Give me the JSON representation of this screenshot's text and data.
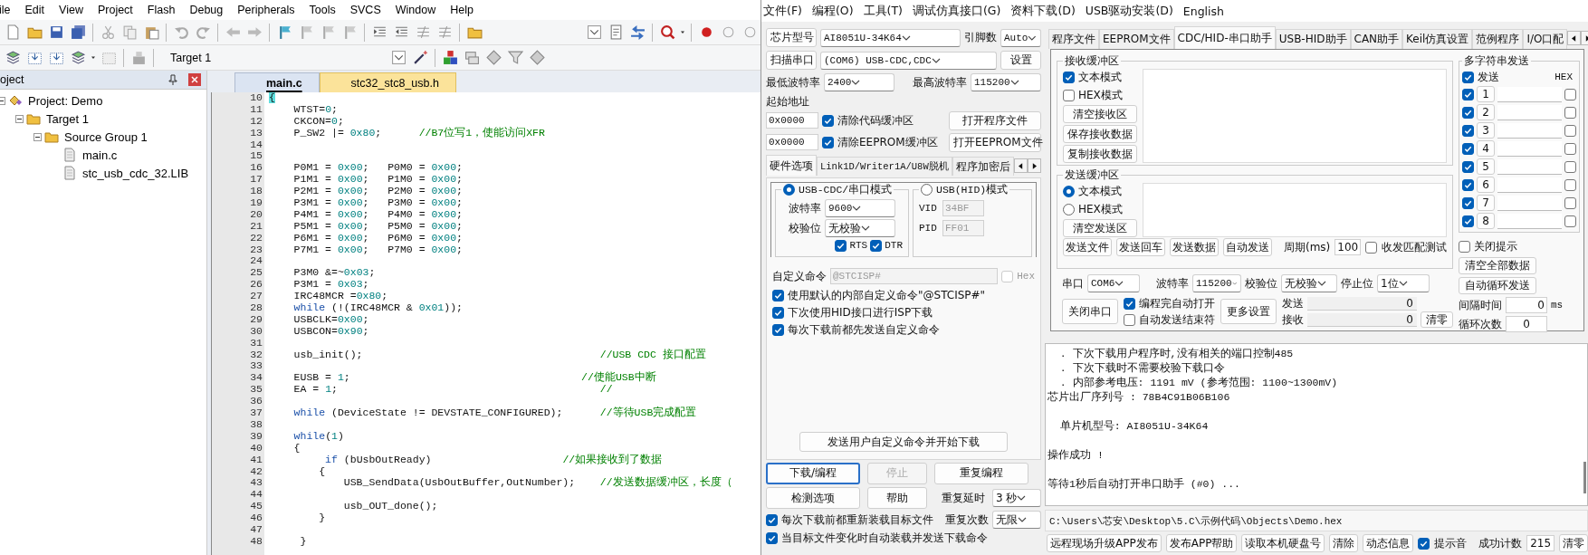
{
  "ide": {
    "menu": [
      "ile",
      "Edit",
      "View",
      "Project",
      "Flash",
      "Debug",
      "Peripherals",
      "Tools",
      "SVCS",
      "Window",
      "Help"
    ],
    "target": "Target 1",
    "project_title": "oject",
    "tree": [
      {
        "label": "Project: Demo",
        "expanded": true,
        "children": [
          {
            "label": "Target 1",
            "expanded": true,
            "children": [
              {
                "label": "Source Group 1",
                "expanded": true,
                "children": [
                  {
                    "label": "main.c"
                  },
                  {
                    "label": "stc_usb_cdc_32.LIB"
                  }
                ]
              }
            ]
          }
        ]
      }
    ],
    "editor_tabs": [
      {
        "label": "main.c",
        "selected": true
      },
      {
        "label": "stc32_stc8_usb.h",
        "selected": false
      }
    ],
    "code": [
      {
        "number": "10",
        "segments": [
          {
            "kind": "brace",
            "text": "{"
          }
        ]
      },
      {
        "number": "11",
        "segments": [
          {
            "kind": "plain",
            "text": "    WTST="
          },
          {
            "kind": "num",
            "text": "0"
          },
          {
            "kind": "plain",
            "text": ";"
          }
        ]
      },
      {
        "number": "12",
        "segments": [
          {
            "kind": "plain",
            "text": "    CKCON="
          },
          {
            "kind": "num",
            "text": "0"
          },
          {
            "kind": "plain",
            "text": ";"
          }
        ]
      },
      {
        "number": "13",
        "segments": [
          {
            "kind": "plain",
            "text": "    P_SW2 |= "
          },
          {
            "kind": "num",
            "text": "0x80"
          },
          {
            "kind": "plain",
            "text": ";      "
          },
          {
            "kind": "cmt",
            "text": "//B7位写1，使能访问XFR"
          }
        ]
      },
      {
        "number": "14"
      },
      {
        "number": "15"
      },
      {
        "number": "16",
        "segments": [
          {
            "kind": "plain",
            "text": "    P0M1 = "
          },
          {
            "kind": "num",
            "text": "0x00"
          },
          {
            "kind": "plain",
            "text": ";   P0M0 = "
          },
          {
            "kind": "num",
            "text": "0x00"
          },
          {
            "kind": "plain",
            "text": ";"
          }
        ]
      },
      {
        "number": "17",
        "segments": [
          {
            "kind": "plain",
            "text": "    P1M1 = "
          },
          {
            "kind": "num",
            "text": "0x00"
          },
          {
            "kind": "plain",
            "text": ";   P1M0 = "
          },
          {
            "kind": "num",
            "text": "0x00"
          },
          {
            "kind": "plain",
            "text": ";"
          }
        ]
      },
      {
        "number": "18",
        "segments": [
          {
            "kind": "plain",
            "text": "    P2M1 = "
          },
          {
            "kind": "num",
            "text": "0x00"
          },
          {
            "kind": "plain",
            "text": ";   P2M0 = "
          },
          {
            "kind": "num",
            "text": "0x00"
          },
          {
            "kind": "plain",
            "text": ";"
          }
        ]
      },
      {
        "number": "19",
        "segments": [
          {
            "kind": "plain",
            "text": "    P3M1 = "
          },
          {
            "kind": "num",
            "text": "0x00"
          },
          {
            "kind": "plain",
            "text": ";   P3M0 = "
          },
          {
            "kind": "num",
            "text": "0x00"
          },
          {
            "kind": "plain",
            "text": ";"
          }
        ]
      },
      {
        "number": "20",
        "segments": [
          {
            "kind": "plain",
            "text": "    P4M1 = "
          },
          {
            "kind": "num",
            "text": "0x00"
          },
          {
            "kind": "plain",
            "text": ";   P4M0 = "
          },
          {
            "kind": "num",
            "text": "0x00"
          },
          {
            "kind": "plain",
            "text": ";"
          }
        ]
      },
      {
        "number": "21",
        "segments": [
          {
            "kind": "plain",
            "text": "    P5M1 = "
          },
          {
            "kind": "num",
            "text": "0x00"
          },
          {
            "kind": "plain",
            "text": ";   P5M0 = "
          },
          {
            "kind": "num",
            "text": "0x00"
          },
          {
            "kind": "plain",
            "text": ";"
          }
        ]
      },
      {
        "number": "22",
        "segments": [
          {
            "kind": "plain",
            "text": "    P6M1 = "
          },
          {
            "kind": "num",
            "text": "0x00"
          },
          {
            "kind": "plain",
            "text": ";   P6M0 = "
          },
          {
            "kind": "num",
            "text": "0x00"
          },
          {
            "kind": "plain",
            "text": ";"
          }
        ]
      },
      {
        "number": "23",
        "segments": [
          {
            "kind": "plain",
            "text": "    P7M1 = "
          },
          {
            "kind": "num",
            "text": "0x00"
          },
          {
            "kind": "plain",
            "text": ";   P7M0 = "
          },
          {
            "kind": "num",
            "text": "0x00"
          },
          {
            "kind": "plain",
            "text": ";"
          }
        ]
      },
      {
        "number": "24"
      },
      {
        "number": "25",
        "segments": [
          {
            "kind": "plain",
            "text": "    P3M0 &=~"
          },
          {
            "kind": "num",
            "text": "0x03"
          },
          {
            "kind": "plain",
            "text": ";"
          }
        ]
      },
      {
        "number": "26",
        "segments": [
          {
            "kind": "plain",
            "text": "    P3M1 = "
          },
          {
            "kind": "num",
            "text": "0x03"
          },
          {
            "kind": "plain",
            "text": ";"
          }
        ]
      },
      {
        "number": "27",
        "segments": [
          {
            "kind": "plain",
            "text": "    IRC48MCR ="
          },
          {
            "kind": "num",
            "text": "0x80"
          },
          {
            "kind": "plain",
            "text": ";"
          }
        ]
      },
      {
        "number": "28",
        "segments": [
          {
            "kind": "kw",
            "text": "    while"
          },
          {
            "kind": "plain",
            "text": " (!(IRC48MCR & "
          },
          {
            "kind": "num",
            "text": "0x01"
          },
          {
            "kind": "plain",
            "text": "));"
          }
        ]
      },
      {
        "number": "29",
        "segments": [
          {
            "kind": "plain",
            "text": "    USBCLK="
          },
          {
            "kind": "num",
            "text": "0x00"
          },
          {
            "kind": "plain",
            "text": ";"
          }
        ]
      },
      {
        "number": "30",
        "segments": [
          {
            "kind": "plain",
            "text": "    USBCON="
          },
          {
            "kind": "num",
            "text": "0x90"
          },
          {
            "kind": "plain",
            "text": ";"
          }
        ]
      },
      {
        "number": "31"
      },
      {
        "number": "32",
        "segments": [
          {
            "kind": "plain",
            "text": "    usb_init();                                      "
          },
          {
            "kind": "cmt",
            "text": "//USB CDC 接口配置"
          }
        ]
      },
      {
        "number": "33"
      },
      {
        "number": "34",
        "segments": [
          {
            "kind": "plain",
            "text": "    EUSB = "
          },
          {
            "kind": "num",
            "text": "1"
          },
          {
            "kind": "plain",
            "text": ";                                     "
          },
          {
            "kind": "cmt",
            "text": "//使能USB中断"
          }
        ]
      },
      {
        "number": "35",
        "segments": [
          {
            "kind": "plain",
            "text": "    EA = "
          },
          {
            "kind": "num",
            "text": "1"
          },
          {
            "kind": "plain",
            "text": ";                                          "
          },
          {
            "kind": "cmt",
            "text": "//"
          }
        ]
      },
      {
        "number": "36"
      },
      {
        "number": "37",
        "segments": [
          {
            "kind": "kw",
            "text": "    while"
          },
          {
            "kind": "plain",
            "text": " (DeviceState != DEVSTATE_CONFIGURED);      "
          },
          {
            "kind": "cmt",
            "text": "//等待USB完成配置"
          }
        ]
      },
      {
        "number": "38"
      },
      {
        "number": "39",
        "segments": [
          {
            "kind": "kw",
            "text": "    while"
          },
          {
            "kind": "plain",
            "text": "("
          },
          {
            "kind": "num",
            "text": "1"
          },
          {
            "kind": "plain",
            "text": ")"
          }
        ]
      },
      {
        "number": "40",
        "segments": [
          {
            "kind": "plain",
            "text": "    {"
          }
        ]
      },
      {
        "number": "41",
        "segments": [
          {
            "kind": "kw",
            "text": "         if"
          },
          {
            "kind": "plain",
            "text": " (bUsbOutReady)                     "
          },
          {
            "kind": "cmt",
            "text": "//如果接收到了数据"
          }
        ]
      },
      {
        "number": "42",
        "segments": [
          {
            "kind": "plain",
            "text": "        {"
          }
        ]
      },
      {
        "number": "43",
        "segments": [
          {
            "kind": "plain",
            "text": "            USB_SendData(UsbOutBuffer,OutNumber);    "
          },
          {
            "kind": "cmt",
            "text": "//发送数据缓冲区，长度（"
          }
        ]
      },
      {
        "number": "44"
      },
      {
        "number": "45",
        "segments": [
          {
            "kind": "plain",
            "text": "            usb_OUT_done();"
          }
        ]
      },
      {
        "number": "46",
        "segments": [
          {
            "kind": "plain",
            "text": "        }"
          }
        ]
      },
      {
        "number": "47"
      },
      {
        "number": "48",
        "segments": [
          {
            "kind": "plain",
            "text": "     }"
          }
        ]
      }
    ]
  },
  "isp": {
    "menu": [
      "文件(F)",
      "编程(O)",
      "工具(T)",
      "调试仿真接口(G)",
      "资料下载(D)",
      "USB驱动安装(D)",
      "English"
    ],
    "chip": {
      "button": "芯片型号",
      "value": "AI8051U-34K64",
      "pins_label": "引脚数",
      "pins": "Auto"
    },
    "port": {
      "button": "扫描串口",
      "value": "(COM6) USB-CDC,CDC",
      "settings": "设置"
    },
    "baud": {
      "min_label": "最低波特率",
      "min": "2400",
      "max_label": "最高波特率",
      "max": "115200"
    },
    "start_label": "起始地址",
    "address_rows": [
      {
        "value": "0x0000",
        "label": "清除代码缓冲区",
        "checked": true,
        "button": "打开程序文件"
      },
      {
        "value": "0x0000",
        "label": "清除EEPROM缓冲区",
        "checked": true,
        "button": "打开EEPROM文件"
      }
    ],
    "option_tabs": [
      {
        "label": "硬件选项",
        "selected": true
      },
      {
        "label": "Link1D/Writer1A/U8W脱机",
        "selected": false
      },
      {
        "label": "程序加密后",
        "selected": false
      }
    ],
    "cdc_mode": {
      "label": "USB-CDC/串口模式",
      "selected": true,
      "baud_label": "波特率",
      "baud": "9600",
      "parity_label": "校验位",
      "parity": "无校验",
      "flags": [
        {
          "label": "RTS",
          "checked": true
        },
        {
          "label": "DTR",
          "checked": true
        }
      ]
    },
    "hid_mode": {
      "label": "USB(HID)模式",
      "selected": false,
      "vid_label": "VID",
      "vid": "34BF",
      "pid_label": "PID",
      "pid": "FF01"
    },
    "custom_cmd": {
      "label": "自定义命令",
      "value": "@STCISP#",
      "disabled": true,
      "hex_label": "Hex",
      "hex_checked": false
    },
    "options": [
      {
        "label": "使用默认的内部自定义命令\"@STCISP#\"",
        "checked": true
      },
      {
        "label": "下次使用HID接口进行ISP下载",
        "checked": true
      },
      {
        "label": "每次下载前都先发送自定义命令",
        "checked": true
      }
    ],
    "send_custom": "发送用户自定义命令并开始下载",
    "actions": [
      {
        "label": "下载/编程",
        "disabled": false,
        "default": true
      },
      {
        "label": "停止",
        "disabled": true,
        "default": false
      },
      {
        "label": "重复编程",
        "disabled": false,
        "default": false
      }
    ],
    "actions2": [
      "检测选项",
      "帮助"
    ],
    "repeat_delay": {
      "label": "重复延时",
      "value": "3 秒"
    },
    "repeat_count": {
      "label": "重复次数",
      "value": "无限"
    },
    "reload_options": [
      {
        "label": "每次下载前都重新装载目标文件",
        "checked": true
      },
      {
        "label": "当目标文件变化时自动装载并发送下载命令",
        "checked": true
      }
    ]
  },
  "assistant": {
    "tabs": [
      {
        "label": "程序文件",
        "selected": false
      },
      {
        "label": "EEPROM文件",
        "selected": false
      },
      {
        "label": "CDC/HID-串口助手",
        "selected": true
      },
      {
        "label": "USB-HID助手",
        "selected": false
      },
      {
        "label": "CAN助手",
        "selected": false
      },
      {
        "label": "Keil仿真设置",
        "selected": false
      },
      {
        "label": "范例程序",
        "selected": false
      },
      {
        "label": "I/O口配",
        "selected": false
      }
    ],
    "receive": {
      "title": "接收缓冲区",
      "modes": [
        {
          "label": "文本模式",
          "checked": true
        },
        {
          "label": "HEX模式",
          "checked": false
        }
      ],
      "buttons": [
        "清空接收区",
        "保存接收数据",
        "复制接收数据"
      ]
    },
    "send": {
      "title": "发送缓冲区",
      "modes": [
        {
          "label": "文本模式",
          "selected": true
        },
        {
          "label": "HEX模式",
          "selected": false
        }
      ],
      "buttons": [
        "清空发送区"
      ]
    },
    "send_buttons": [
      "发送文件",
      "发送回车",
      "发送数据",
      "自动发送"
    ],
    "period_label": "周期(ms)",
    "period": "100",
    "match_test": {
      "label": "收发匹配测试",
      "checked": false
    },
    "serial": {
      "port_label": "串口",
      "port": "COM6",
      "baud_label": "波特率",
      "baud": "115200",
      "parity_label": "校验位",
      "parity": "无校验",
      "stop_label": "停止位",
      "stop": "1位"
    },
    "close_port": "关闭串口",
    "auto_options": [
      {
        "label": "编程完自动打开",
        "checked": true
      },
      {
        "label": "自动发送结束符",
        "checked": false
      }
    ],
    "more_settings": "更多设置",
    "counters": [
      {
        "label": "发送",
        "value": "0"
      },
      {
        "label": "接收",
        "value": "0"
      }
    ],
    "clear": "清零",
    "multi": {
      "title": "多字符串发送",
      "send": {
        "label": "发送",
        "checked": true
      },
      "hex_header": "HEX",
      "rows": [
        {
          "number": "1",
          "checked": true,
          "hex": false
        },
        {
          "number": "2",
          "checked": true,
          "hex": false
        },
        {
          "number": "3",
          "checked": true,
          "hex": false
        },
        {
          "number": "4",
          "checked": true,
          "hex": false
        },
        {
          "number": "5",
          "checked": true,
          "hex": false
        },
        {
          "number": "6",
          "checked": true,
          "hex": false
        },
        {
          "number": "7",
          "checked": true,
          "hex": false
        },
        {
          "number": "8",
          "checked": true,
          "hex": false
        }
      ]
    },
    "close_hint": {
      "label": "关闭提示",
      "checked": false
    },
    "multi_buttons": [
      "清空全部数据",
      "自动循环发送"
    ],
    "interval": {
      "label": "间隔时间",
      "value": "0",
      "unit": "ms"
    },
    "loops": {
      "label": "循环次数",
      "value": "0"
    },
    "log": [
      {
        "text": "  . 下次下载用户程序时,没有相关的端口控制485",
        "spaced": false
      },
      {
        "text": "  . 下次下载时不需要校验下载口令",
        "spaced": false
      },
      {
        "text": "  . 内部参考电压: 1191 mV (参考范围: 1100~1300mV)",
        "spaced": false
      },
      {
        "text": "芯片出厂序列号 : 78B4C91B06B106",
        "spaced": false
      },
      {
        "text": "  单片机型号: AI8051U-34K64",
        "spaced": true
      },
      {
        "text": "操作成功 !",
        "spaced": true
      },
      {
        "text": "等待1秒后自动打开串口助手 (#0) ...",
        "spaced": true
      }
    ],
    "path": "C:\\Users\\芯安\\Desktop\\5.C\\示例代码\\Objects\\Demo.hex",
    "bottom_buttons": [
      "远程现场升级APP发布",
      "发布APP帮助",
      "读取本机硬盘号",
      "清除",
      "动态信息"
    ],
    "beep": {
      "label": "提示音",
      "checked": true
    },
    "success": {
      "label": "成功计数",
      "value": "215",
      "button": "清零"
    }
  }
}
